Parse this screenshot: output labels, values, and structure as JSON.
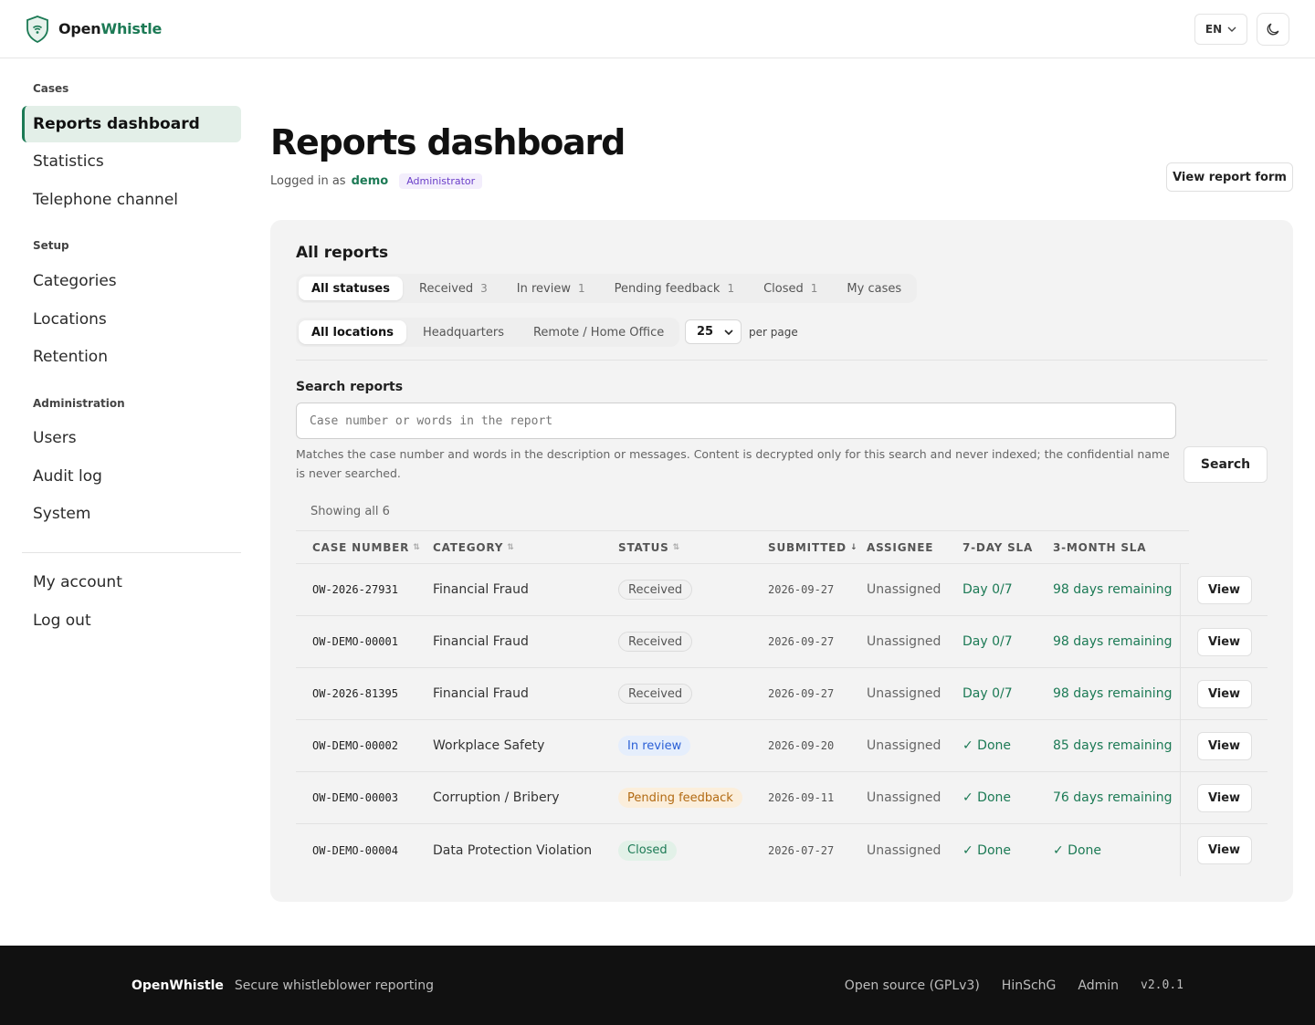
{
  "brand": {
    "name_primary": "Open",
    "name_accent": "Whistle"
  },
  "header": {
    "language": "EN"
  },
  "sidebar": {
    "sections": [
      {
        "title": "Cases",
        "items": [
          "Reports dashboard",
          "Statistics",
          "Telephone channel"
        ]
      },
      {
        "title": "Setup",
        "items": [
          "Categories",
          "Locations",
          "Retention"
        ]
      },
      {
        "title": "Administration",
        "items": [
          "Users",
          "Audit log",
          "System"
        ]
      }
    ],
    "account_items": [
      "My account",
      "Log out"
    ],
    "active_item": "Reports dashboard"
  },
  "page": {
    "title": "Reports dashboard",
    "logged_in_prefix": "Logged in as",
    "username": "demo",
    "role": "Administrator",
    "view_form_label": "View report form"
  },
  "panel": {
    "title": "All reports",
    "status_filters": [
      {
        "label": "All statuses",
        "count": ""
      },
      {
        "label": "Received",
        "count": "3"
      },
      {
        "label": "In review",
        "count": "1"
      },
      {
        "label": "Pending feedback",
        "count": "1"
      },
      {
        "label": "Closed",
        "count": "1"
      },
      {
        "label": "My cases",
        "count": ""
      }
    ],
    "location_filters": [
      "All locations",
      "Headquarters",
      "Remote / Home Office"
    ],
    "per_page_value": "25",
    "per_page_label": "per page",
    "search": {
      "label": "Search reports",
      "placeholder": "Case number or words in the report",
      "help": "Matches the case number and words in the description or messages. Content is decrypted only for this search and never indexed; the confidential name is never searched.",
      "button": "Search"
    },
    "showing": "Showing all 6",
    "columns": [
      "CASE NUMBER",
      "CATEGORY",
      "STATUS",
      "SUBMITTED",
      "ASSIGNEE",
      "7-DAY SLA",
      "3-MONTH SLA"
    ],
    "rows": [
      {
        "case": "OW-2026-27931",
        "category": "Financial Fraud",
        "status": "Received",
        "status_kind": "received",
        "submitted": "2026-09-27",
        "assignee": "Unassigned",
        "sla7": "Day 0/7",
        "sla3": "98 days remaining",
        "action": "View"
      },
      {
        "case": "OW-DEMO-00001",
        "category": "Financial Fraud",
        "status": "Received",
        "status_kind": "received",
        "submitted": "2026-09-27",
        "assignee": "Unassigned",
        "sla7": "Day 0/7",
        "sla3": "98 days remaining",
        "action": "View"
      },
      {
        "case": "OW-2026-81395",
        "category": "Financial Fraud",
        "status": "Received",
        "status_kind": "received",
        "submitted": "2026-09-27",
        "assignee": "Unassigned",
        "sla7": "Day 0/7",
        "sla3": "98 days remaining",
        "action": "View"
      },
      {
        "case": "OW-DEMO-00002",
        "category": "Workplace Safety",
        "status": "In review",
        "status_kind": "inreview",
        "submitted": "2026-09-20",
        "assignee": "Unassigned",
        "sla7": "✓ Done",
        "sla3": "85 days remaining",
        "action": "View"
      },
      {
        "case": "OW-DEMO-00003",
        "category": "Corruption / Bribery",
        "status": "Pending feedback",
        "status_kind": "pending",
        "submitted": "2026-09-11",
        "assignee": "Unassigned",
        "sla7": "✓ Done",
        "sla3": "76 days remaining",
        "action": "View"
      },
      {
        "case": "OW-DEMO-00004",
        "category": "Data Protection Violation",
        "status": "Closed",
        "status_kind": "closed",
        "submitted": "2026-07-27",
        "assignee": "Unassigned",
        "sla7": "✓ Done",
        "sla3": "✓ Done",
        "action": "View"
      }
    ]
  },
  "footer": {
    "brand": "OpenWhistle",
    "tagline": "Secure whistleblower reporting",
    "links": [
      "Open source (GPLv3)",
      "HinSchG",
      "Admin"
    ],
    "version": "v2.0.1"
  },
  "colors": {
    "accent": "#1c7a55",
    "role": "#6b3fc9",
    "footer_bg": "#111111"
  }
}
